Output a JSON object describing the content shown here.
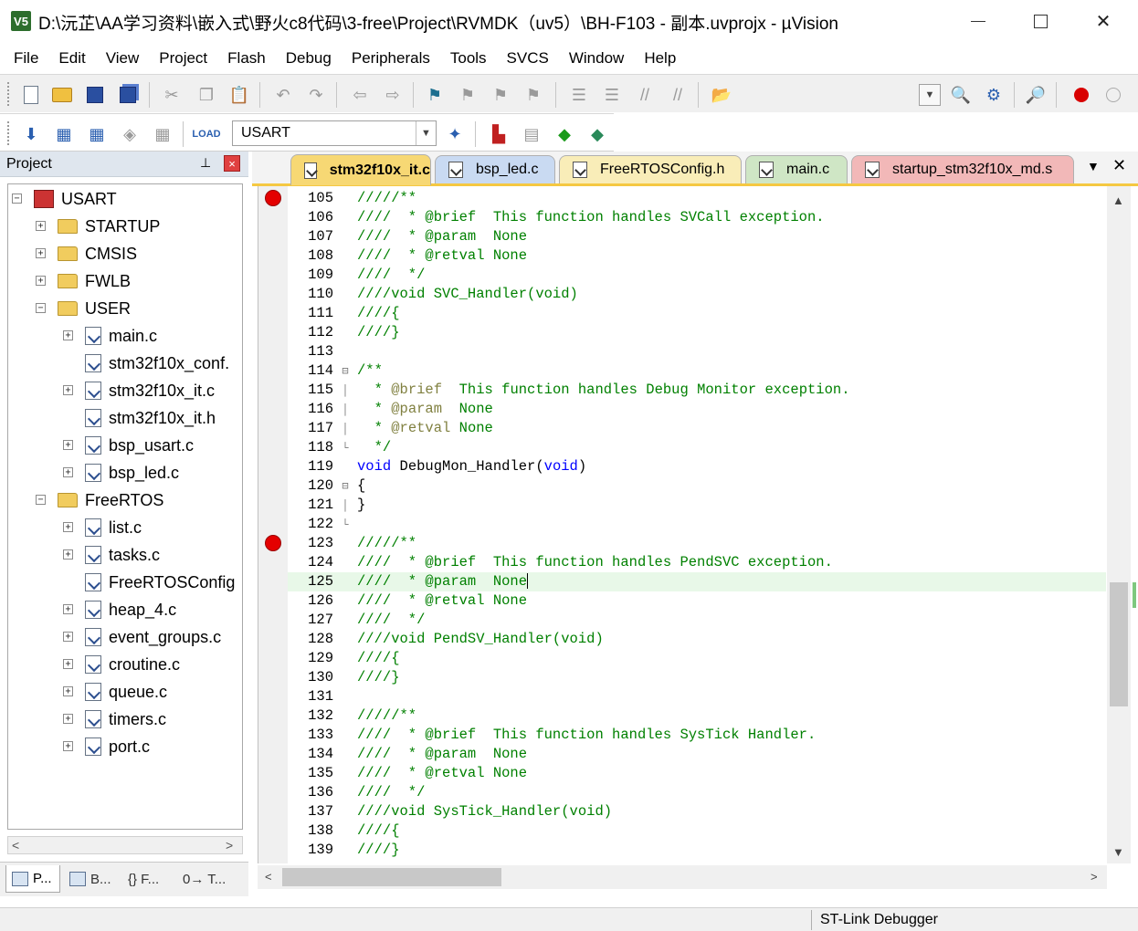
{
  "window": {
    "title": "D:\\沅芷\\AA学习资料\\嵌入式\\野火c8代码\\3-free\\Project\\RVMDK（uv5）\\BH-F103 - 副本.uvprojx - µVision",
    "app_icon_text": "V5",
    "close_glyph": "✕"
  },
  "menu": [
    "File",
    "Edit",
    "View",
    "Project",
    "Flash",
    "Debug",
    "Peripherals",
    "Tools",
    "SVCS",
    "Window",
    "Help"
  ],
  "toolbar": {
    "target_select": "USART",
    "dropdown_glyph": "▼"
  },
  "project_panel": {
    "title": "Project",
    "pin_glyph": "📌",
    "close_glyph": "×",
    "tree": [
      {
        "label": "USART",
        "level": 0,
        "type": "target",
        "expander": "−"
      },
      {
        "label": "STARTUP",
        "level": 1,
        "type": "folder",
        "expander": "+"
      },
      {
        "label": "CMSIS",
        "level": 1,
        "type": "folder",
        "expander": "+"
      },
      {
        "label": "FWLB",
        "level": 1,
        "type": "folder",
        "expander": "+"
      },
      {
        "label": "USER",
        "level": 1,
        "type": "folder",
        "expander": "−"
      },
      {
        "label": "main.c",
        "level": 2,
        "type": "file",
        "expander": "+"
      },
      {
        "label": "stm32f10x_conf.",
        "level": 2,
        "type": "file",
        "expander": ""
      },
      {
        "label": "stm32f10x_it.c",
        "level": 2,
        "type": "file",
        "expander": "+"
      },
      {
        "label": "stm32f10x_it.h",
        "level": 2,
        "type": "file",
        "expander": ""
      },
      {
        "label": "bsp_usart.c",
        "level": 2,
        "type": "file",
        "expander": "+"
      },
      {
        "label": "bsp_led.c",
        "level": 2,
        "type": "file",
        "expander": "+"
      },
      {
        "label": "FreeRTOS",
        "level": 1,
        "type": "folder",
        "expander": "−"
      },
      {
        "label": "list.c",
        "level": 2,
        "type": "file",
        "expander": "+"
      },
      {
        "label": "tasks.c",
        "level": 2,
        "type": "file",
        "expander": "+"
      },
      {
        "label": "FreeRTOSConfig",
        "level": 2,
        "type": "file",
        "expander": ""
      },
      {
        "label": "heap_4.c",
        "level": 2,
        "type": "file",
        "expander": "+"
      },
      {
        "label": "event_groups.c",
        "level": 2,
        "type": "file",
        "expander": "+"
      },
      {
        "label": "croutine.c",
        "level": 2,
        "type": "file",
        "expander": "+"
      },
      {
        "label": "queue.c",
        "level": 2,
        "type": "file",
        "expander": "+"
      },
      {
        "label": "timers.c",
        "level": 2,
        "type": "file",
        "expander": "+"
      },
      {
        "label": "port.c",
        "level": 2,
        "type": "file",
        "expander": "+"
      }
    ],
    "tabs": [
      "P...",
      "B...",
      "{} F...",
      "0→ T..."
    ],
    "scroll_left": "<",
    "scroll_right": ">"
  },
  "editor": {
    "tabs": [
      {
        "label": "stm32f10x_it.c",
        "active": true,
        "color": "#f7d874"
      },
      {
        "label": "bsp_led.c",
        "active": false,
        "color": "#c9daf2"
      },
      {
        "label": "FreeRTOSConfig.h",
        "active": false,
        "color": "#f9edb8"
      },
      {
        "label": "main.c",
        "active": false,
        "color": "#cfe6c5"
      },
      {
        "label": "startup_stm32f10x_md.s",
        "active": false,
        "color": "#f2b8b8"
      }
    ],
    "tab_menu_glyph": "▼",
    "tab_close_glyph": "✕",
    "lines": [
      {
        "no": "105",
        "fold": "",
        "bp": true,
        "parts": [
          {
            "t": "/////**",
            "c": "doc"
          }
        ]
      },
      {
        "no": "106",
        "fold": "",
        "parts": [
          {
            "t": "////  * @brief  This function handles SVCall exception.",
            "c": "doc"
          }
        ]
      },
      {
        "no": "107",
        "fold": "",
        "parts": [
          {
            "t": "////  * @param  None",
            "c": "doc"
          }
        ]
      },
      {
        "no": "108",
        "fold": "",
        "parts": [
          {
            "t": "////  * @retval None",
            "c": "doc"
          }
        ]
      },
      {
        "no": "109",
        "fold": "",
        "parts": [
          {
            "t": "////  */",
            "c": "doc"
          }
        ]
      },
      {
        "no": "110",
        "fold": "",
        "parts": [
          {
            "t": "////void SVC_Handler(void)",
            "c": "doc"
          }
        ]
      },
      {
        "no": "111",
        "fold": "",
        "parts": [
          {
            "t": "////{",
            "c": "doc"
          }
        ]
      },
      {
        "no": "112",
        "fold": "",
        "parts": [
          {
            "t": "////}",
            "c": "doc"
          }
        ]
      },
      {
        "no": "113",
        "fold": "",
        "parts": []
      },
      {
        "no": "114",
        "fold": "⊟",
        "parts": [
          {
            "t": "/**",
            "c": "doc"
          }
        ]
      },
      {
        "no": "115",
        "fold": "│",
        "parts": [
          {
            "t": "  * ",
            "c": "doc"
          },
          {
            "t": "@brief",
            "c": "tag"
          },
          {
            "t": "  This function handles Debug Monitor exception.",
            "c": "doc"
          }
        ]
      },
      {
        "no": "116",
        "fold": "│",
        "parts": [
          {
            "t": "  * ",
            "c": "doc"
          },
          {
            "t": "@param",
            "c": "tag"
          },
          {
            "t": "  None",
            "c": "doc"
          }
        ]
      },
      {
        "no": "117",
        "fold": "│",
        "parts": [
          {
            "t": "  * ",
            "c": "doc"
          },
          {
            "t": "@retval",
            "c": "tag"
          },
          {
            "t": " None",
            "c": "doc"
          }
        ]
      },
      {
        "no": "118",
        "fold": "└",
        "parts": [
          {
            "t": "  */",
            "c": "doc"
          }
        ]
      },
      {
        "no": "119",
        "fold": "",
        "parts": [
          {
            "t": "void",
            "c": "kw"
          },
          {
            "t": " DebugMon_Handler(",
            "c": "plain"
          },
          {
            "t": "void",
            "c": "kw"
          },
          {
            "t": ")",
            "c": "plain"
          }
        ]
      },
      {
        "no": "120",
        "fold": "⊟",
        "parts": [
          {
            "t": "{",
            "c": "plain"
          }
        ]
      },
      {
        "no": "121",
        "fold": "│",
        "parts": [
          {
            "t": "}",
            "c": "plain"
          }
        ]
      },
      {
        "no": "122",
        "fold": "└",
        "parts": []
      },
      {
        "no": "123",
        "fold": "",
        "bp": true,
        "parts": [
          {
            "t": "/////**",
            "c": "doc"
          }
        ]
      },
      {
        "no": "124",
        "fold": "",
        "parts": [
          {
            "t": "////  * @brief  This function handles PendSVC exception.",
            "c": "doc"
          }
        ]
      },
      {
        "no": "125",
        "fold": "",
        "current": true,
        "parts": [
          {
            "t": "////  * @param  None",
            "c": "doc"
          }
        ]
      },
      {
        "no": "126",
        "fold": "",
        "parts": [
          {
            "t": "////  * @retval None",
            "c": "doc"
          }
        ]
      },
      {
        "no": "127",
        "fold": "",
        "parts": [
          {
            "t": "////  */",
            "c": "doc"
          }
        ]
      },
      {
        "no": "128",
        "fold": "",
        "parts": [
          {
            "t": "////void PendSV_Handler(void)",
            "c": "doc"
          }
        ]
      },
      {
        "no": "129",
        "fold": "",
        "parts": [
          {
            "t": "////{",
            "c": "doc"
          }
        ]
      },
      {
        "no": "130",
        "fold": "",
        "parts": [
          {
            "t": "////}",
            "c": "doc"
          }
        ]
      },
      {
        "no": "131",
        "fold": "",
        "parts": []
      },
      {
        "no": "132",
        "fold": "",
        "parts": [
          {
            "t": "/////**",
            "c": "doc"
          }
        ]
      },
      {
        "no": "133",
        "fold": "",
        "parts": [
          {
            "t": "////  * @brief  This function handles SysTick Handler.",
            "c": "doc"
          }
        ]
      },
      {
        "no": "134",
        "fold": "",
        "parts": [
          {
            "t": "////  * @param  None",
            "c": "doc"
          }
        ]
      },
      {
        "no": "135",
        "fold": "",
        "parts": [
          {
            "t": "////  * @retval None",
            "c": "doc"
          }
        ]
      },
      {
        "no": "136",
        "fold": "",
        "parts": [
          {
            "t": "////  */",
            "c": "doc"
          }
        ]
      },
      {
        "no": "137",
        "fold": "",
        "parts": [
          {
            "t": "////void SysTick_Handler(void)",
            "c": "doc"
          }
        ]
      },
      {
        "no": "138",
        "fold": "",
        "parts": [
          {
            "t": "////{",
            "c": "doc"
          }
        ]
      },
      {
        "no": "139",
        "fold": "",
        "parts": [
          {
            "t": "////}",
            "c": "doc"
          }
        ]
      }
    ],
    "scroll_up": "▲",
    "scroll_down": "▼",
    "scroll_left": "<",
    "scroll_right": ">"
  },
  "status": {
    "debugger": "ST-Link Debugger"
  }
}
